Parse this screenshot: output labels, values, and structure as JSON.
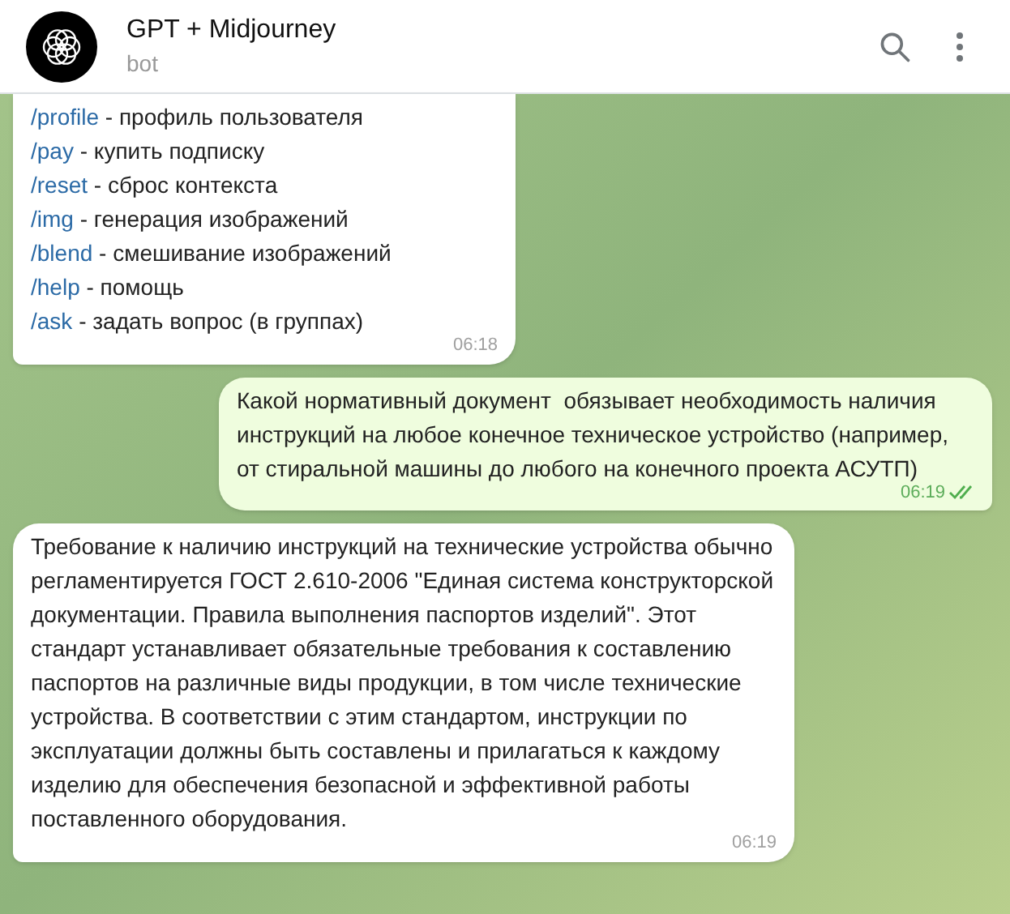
{
  "header": {
    "title": "GPT + Midjourney",
    "subtitle": "bot"
  },
  "messages": [
    {
      "kind": "commands",
      "outgoing": false,
      "time": "06:18",
      "items": [
        {
          "command": "/profile",
          "description": " - профиль пользователя"
        },
        {
          "command": "/pay",
          "description": " - купить подписку"
        },
        {
          "command": "/reset",
          "description": " - сброс контекста"
        },
        {
          "command": "/img",
          "description": " - генерация изображений"
        },
        {
          "command": "/blend",
          "description": " - смешивание изображений"
        },
        {
          "command": "/help",
          "description": " - помощь"
        },
        {
          "command": "/ask",
          "description": " - задать вопрос (в группах)"
        }
      ]
    },
    {
      "kind": "text",
      "outgoing": true,
      "read": true,
      "time": "06:19",
      "text": "Какой нормативный документ  обязывает необходимость наличия инструкций на любое конечное техническое устройство (например, от стиральной машины до любого на конечного проекта АСУТП)"
    },
    {
      "kind": "text",
      "outgoing": false,
      "time": "06:19",
      "text": "Требование к наличию инструкций на технические устройства обычно регламентируется ГОСТ 2.610-2006 \"Единая система конструкторской документации. Правила выполнения паспортов изделий\". Этот стандарт устанавливает обязательные требования к составлению паспортов на различные виды продукции, в том числе технические устройства. В соответствии с этим стандартом, инструкции по эксплуатации должны быть составлены и прилагаться к каждому изделию для обеспечения безопасной и эффективной работы поставленного оборудования."
    }
  ]
}
